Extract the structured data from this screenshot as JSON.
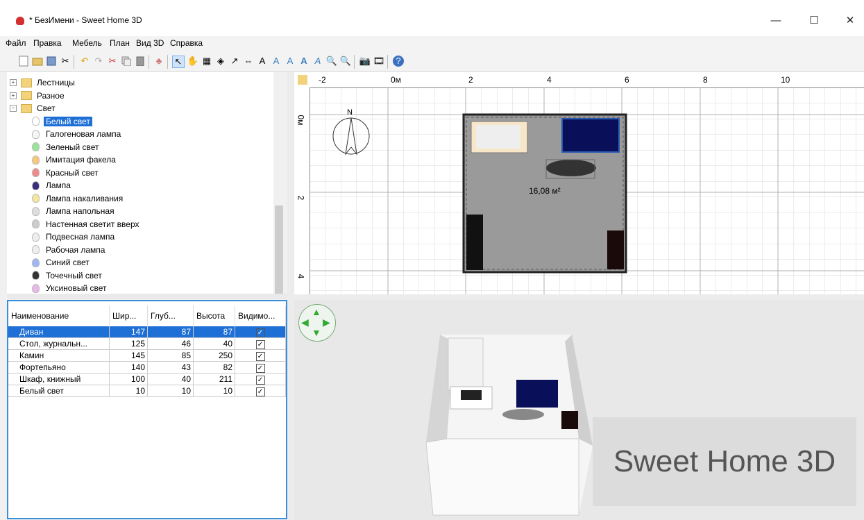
{
  "window": {
    "title": "* БезИмени - Sweet Home 3D",
    "minimize": "—",
    "maximize": "☐",
    "close": "✕"
  },
  "menu": [
    "Файл",
    "Правка",
    "Мебель",
    "План",
    "Вид 3D",
    "Справка"
  ],
  "toolbar": {
    "icons": [
      "new-file-icon",
      "open-icon",
      "save-icon",
      "cut-icon",
      "undo-icon",
      "redo-icon",
      "cut-icon",
      "copy-icon",
      "paste-icon",
      "add-furniture-icon",
      "select-icon",
      "pan-icon",
      "create-walls-icon",
      "create-rooms-icon",
      "create-polylines-icon",
      "create-dimensions-icon",
      "add-text-icon",
      "zoom-in-icon",
      "zoom-out-icon",
      "increase-text-icon",
      "decrease-text-icon",
      "bold-icon",
      "italic-icon",
      "photo-icon",
      "video-icon",
      "help-icon"
    ]
  },
  "tree": {
    "items": [
      {
        "label": "Лестницы",
        "type": "folder",
        "expander": "+"
      },
      {
        "label": "Разное",
        "type": "folder",
        "expander": "+"
      },
      {
        "label": "Свет",
        "type": "folder",
        "expander": "−"
      },
      {
        "label": "Белый свет",
        "type": "light",
        "color": "#ffffff",
        "selected": true
      },
      {
        "label": "Галогеновая лампа",
        "type": "light",
        "color": "#f5f5f5"
      },
      {
        "label": "Зеленый свет",
        "type": "light",
        "color": "#9be39b"
      },
      {
        "label": "Имитация факела",
        "type": "light",
        "color": "#f6c87d"
      },
      {
        "label": "Красный свет",
        "type": "light",
        "color": "#f08a8a"
      },
      {
        "label": "Лампа",
        "type": "light",
        "color": "#3a2e7a"
      },
      {
        "label": "Лампа накаливания",
        "type": "light",
        "color": "#f3e6a0"
      },
      {
        "label": "Лампа напольная",
        "type": "light",
        "color": "#dddddd"
      },
      {
        "label": "Настенная светит вверх",
        "type": "light",
        "color": "#cccccc"
      },
      {
        "label": "Подвесная лампа",
        "type": "light",
        "color": "#eeeeee"
      },
      {
        "label": "Рабочая лампа",
        "type": "light",
        "color": "#eeeeee"
      },
      {
        "label": "Синий свет",
        "type": "light",
        "color": "#9fb8f2"
      },
      {
        "label": "Точечный свет",
        "type": "light",
        "color": "#333333"
      },
      {
        "label": "Уксиновый свет",
        "type": "light",
        "color": "#e8b9e8"
      }
    ]
  },
  "furniture_table": {
    "headers": [
      "Наименование",
      "Шир...",
      "Глуб...",
      "Высота",
      "Видимо..."
    ],
    "rows": [
      {
        "name": "Диван",
        "w": "147",
        "d": "87",
        "h": "87",
        "selected": true
      },
      {
        "name": "Стол, журнальн...",
        "w": "125",
        "d": "46",
        "h": "40"
      },
      {
        "name": "Камин",
        "w": "145",
        "d": "85",
        "h": "250"
      },
      {
        "name": "Фортепьяно",
        "w": "140",
        "d": "43",
        "h": "82"
      },
      {
        "name": "Шкаф, книжный",
        "w": "100",
        "d": "40",
        "h": "211"
      },
      {
        "name": "Белый свет",
        "w": "10",
        "d": "10",
        "h": "10"
      }
    ]
  },
  "plan": {
    "ruler_h": [
      "-2",
      "0м",
      "2",
      "4",
      "6",
      "8",
      "10"
    ],
    "ruler_v": [
      "0м",
      "2",
      "4"
    ],
    "room_area": "16,08 м²",
    "compass_label": "N"
  },
  "view3d": {
    "watermark": "Sweet Home 3D"
  },
  "colors": {
    "selection": "#1e6fd6",
    "room_floor": "#9a9a9a",
    "sofa": "#0a0f5a"
  }
}
